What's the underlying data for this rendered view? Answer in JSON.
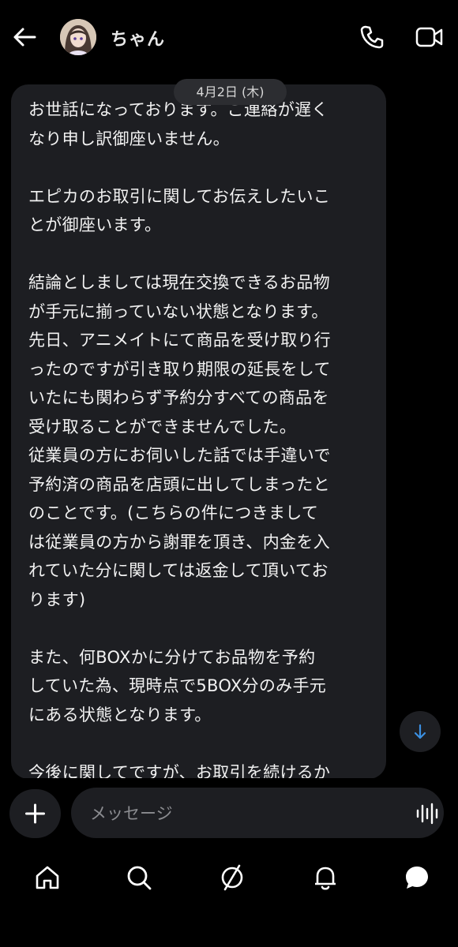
{
  "header": {
    "contact_name": "ちゃん"
  },
  "conversation": {
    "date_label": "4月2日 (木)",
    "message_text": "お世話になっております。ご連絡が遅く\nなり申し訳御座いません。\n\nエピカのお取引に関してお伝えしたいこ\nとが御座います。\n\n結論としましては現在交換できるお品物\nが手元に揃っていない状態となります。\n先日、アニメイトにて商品を受け取り行\nったのですが引き取り期限の延長をして\nいたにも関わらず予約分すべての商品を\n受け取ることができませんでした。\n従業員の方にお伺いした話では手違いで\n予約済の商品を店頭に出してしまったと\nのことです。(こちらの件につきまして\nは従業員の方から謝罪を頂き、内金を入\nれていた分に関しては返金して頂いてお\nります)\n\nまた、何BOXかに分けてお品物を予約\nしていた為、現時点で5BOX分のみ手元\nにある状態となります。\n\n今後に関してですが、お取引を続けるか"
  },
  "composer": {
    "placeholder": "メッセージ"
  },
  "icons": {
    "back": "arrow-left-icon",
    "call": "phone-icon",
    "video": "video-camera-icon",
    "add": "plus-icon",
    "voice": "audio-waveform-icon",
    "scroll": "arrow-down-icon",
    "nav": [
      "home-icon",
      "search-icon",
      "explore-icon",
      "notifications-icon",
      "messages-icon"
    ]
  },
  "colors": {
    "background": "#000000",
    "bubble": "#1d1e22",
    "accent": "#3b8fe0"
  }
}
